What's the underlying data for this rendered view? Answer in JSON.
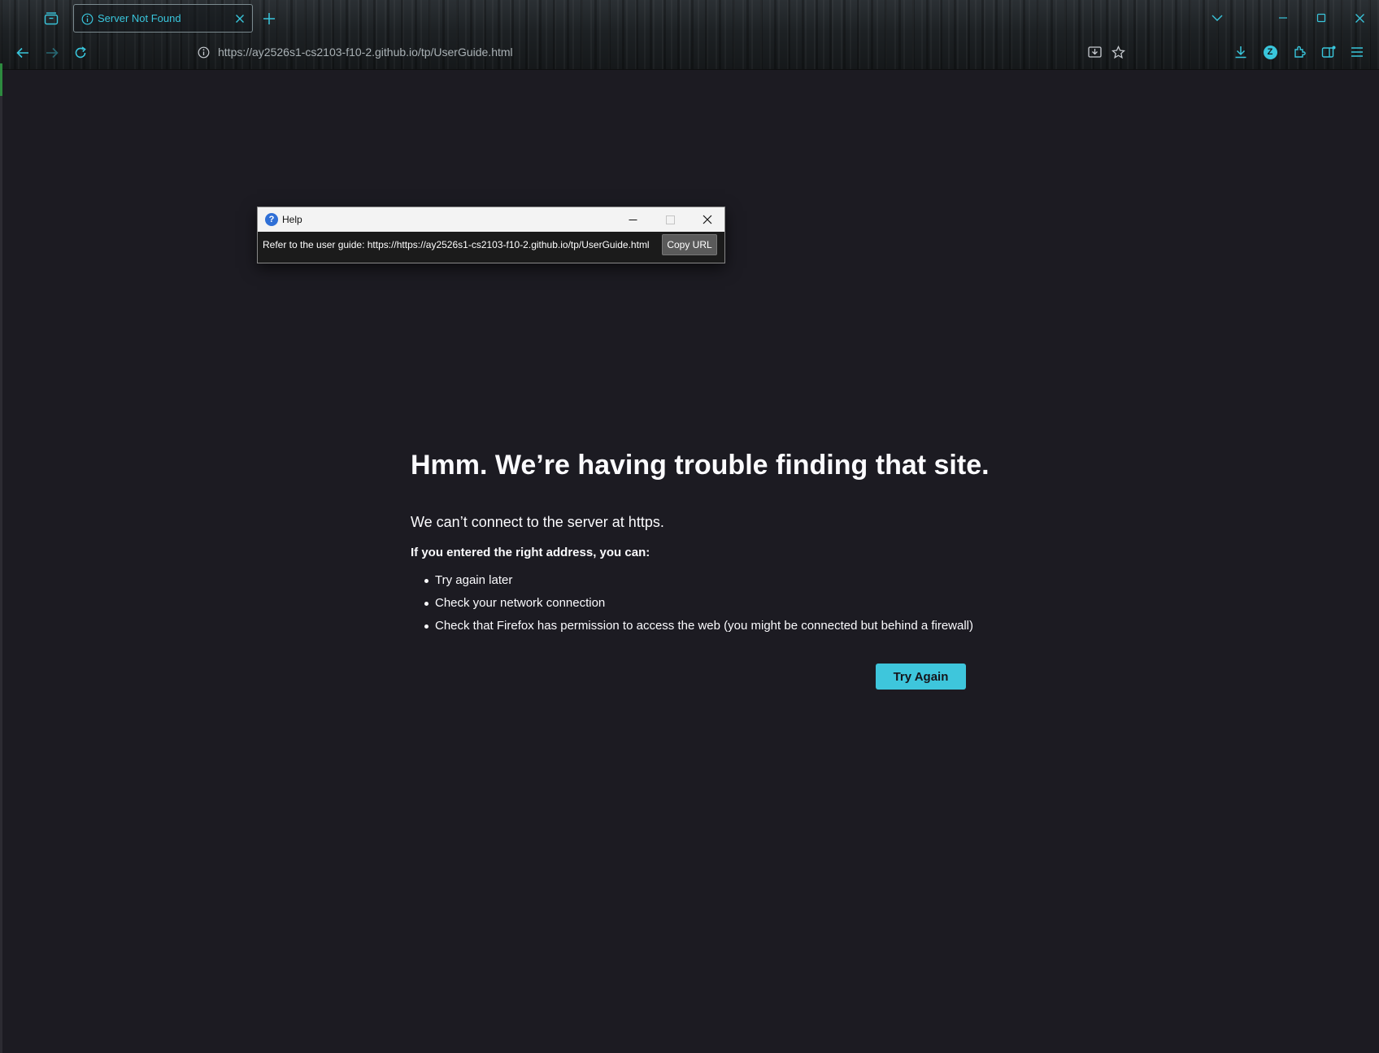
{
  "browser": {
    "tab_title": "Server Not Found",
    "url": "https://ay2526s1-cs2103-f10-2.github.io/tp/UserGuide.html",
    "accent": "#39c6dc",
    "icons": [
      "tab-manager-icon",
      "info-icon",
      "close-tab-icon",
      "new-tab-icon",
      "list-all-tabs-icon",
      "minimize-icon",
      "maximize-icon",
      "close-window-icon",
      "back-icon",
      "forward-icon",
      "reload-icon",
      "site-info-icon",
      "save-to-pocket-icon",
      "bookmark-star-icon",
      "downloads-icon",
      "account-icon",
      "extensions-icon",
      "sidebar-icon",
      "menu-icon"
    ],
    "account_initial": "Z"
  },
  "error_page": {
    "title": "Hmm. We’re having trouble finding that site.",
    "description": "We can’t connect to the server at https.",
    "subtitle": "If you entered the right address, you can:",
    "suggestions": [
      "Try again later",
      "Check your network connection",
      "Check that Firefox has permission to access the web (you might be connected but behind a firewall)"
    ],
    "try_again_label": "Try Again",
    "button_color": "#3ec6dc"
  },
  "help_dialog": {
    "title": "Help",
    "help_icon_glyph": "?",
    "message": "Refer to the user guide: https://https://ay2526s1-cs2103-f10-2.github.io/tp/UserGuide.html",
    "copy_label": "Copy URL"
  }
}
